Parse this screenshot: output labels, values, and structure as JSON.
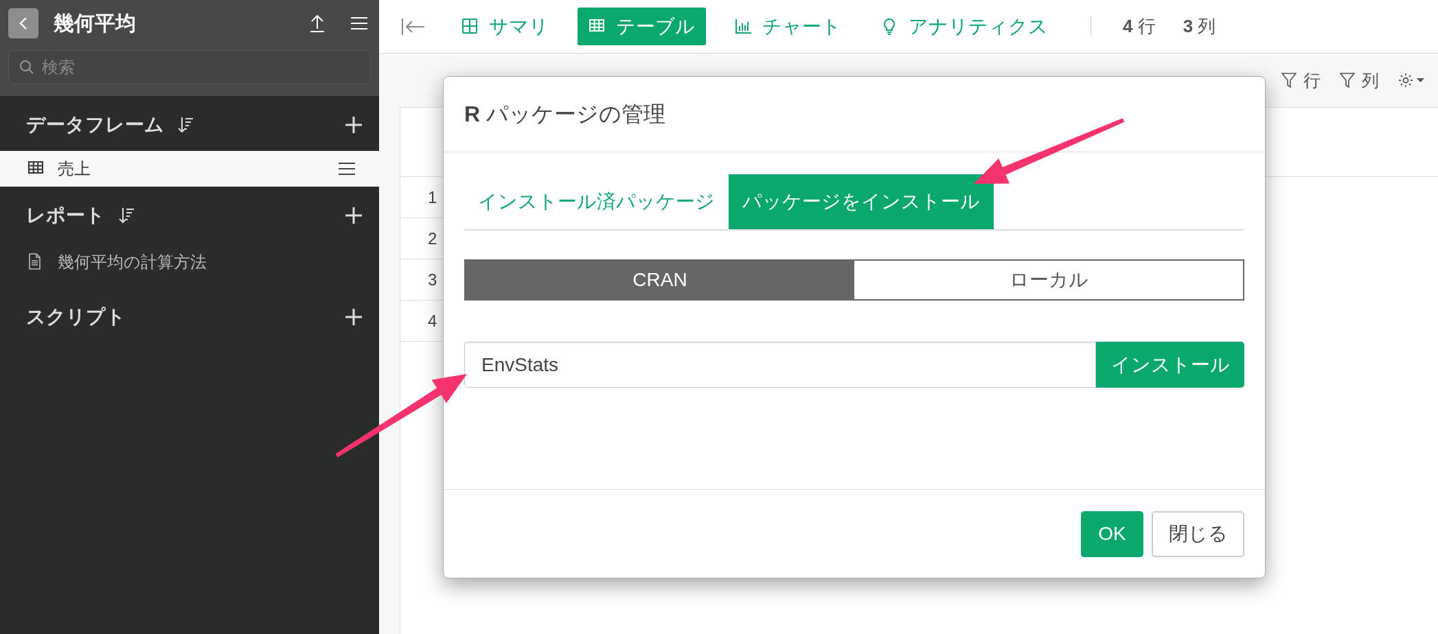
{
  "sidebar": {
    "title": "幾何平均",
    "search": {
      "placeholder": "検索"
    },
    "sections": [
      {
        "title": "データフレーム",
        "sortable": true,
        "items": [
          {
            "label": "売上",
            "kind": "table",
            "selected": true
          }
        ]
      },
      {
        "title": "レポート",
        "sortable": true,
        "items": [
          {
            "label": "幾何平均の計算方法",
            "kind": "document",
            "selected": false
          }
        ]
      },
      {
        "title": "スクリプト",
        "sortable": false
      }
    ]
  },
  "toolbar": {
    "tabs": [
      {
        "label": "サマリ",
        "kind": "summary",
        "selected": false
      },
      {
        "label": "テーブル",
        "kind": "table",
        "selected": true
      },
      {
        "label": "チャート",
        "kind": "chart",
        "selected": false
      },
      {
        "label": "アナリティクス",
        "kind": "analytics",
        "selected": false
      }
    ],
    "counts": [
      {
        "value": "4",
        "unit": "行"
      },
      {
        "value": "3",
        "unit": "列"
      }
    ]
  },
  "filters": [
    {
      "label": "行"
    },
    {
      "label": "列"
    }
  ],
  "table": {
    "row_numbers": [
      "1",
      "2",
      "3",
      "4"
    ]
  },
  "dialog": {
    "title": "**R** パッケージの管理",
    "tabs": [
      {
        "label": "インストール済パッケージ",
        "selected": false
      },
      {
        "label": "パッケージをインストール",
        "selected": true
      }
    ],
    "sources": [
      {
        "label": "CRAN",
        "selected": true
      },
      {
        "label": "ローカル",
        "selected": false
      }
    ],
    "package_input": {
      "value": "EnvStats"
    },
    "install_button": "インストール",
    "buttons": [
      {
        "label": "OK",
        "kind": "primary"
      },
      {
        "label": "閉じる",
        "kind": "default"
      }
    ]
  }
}
